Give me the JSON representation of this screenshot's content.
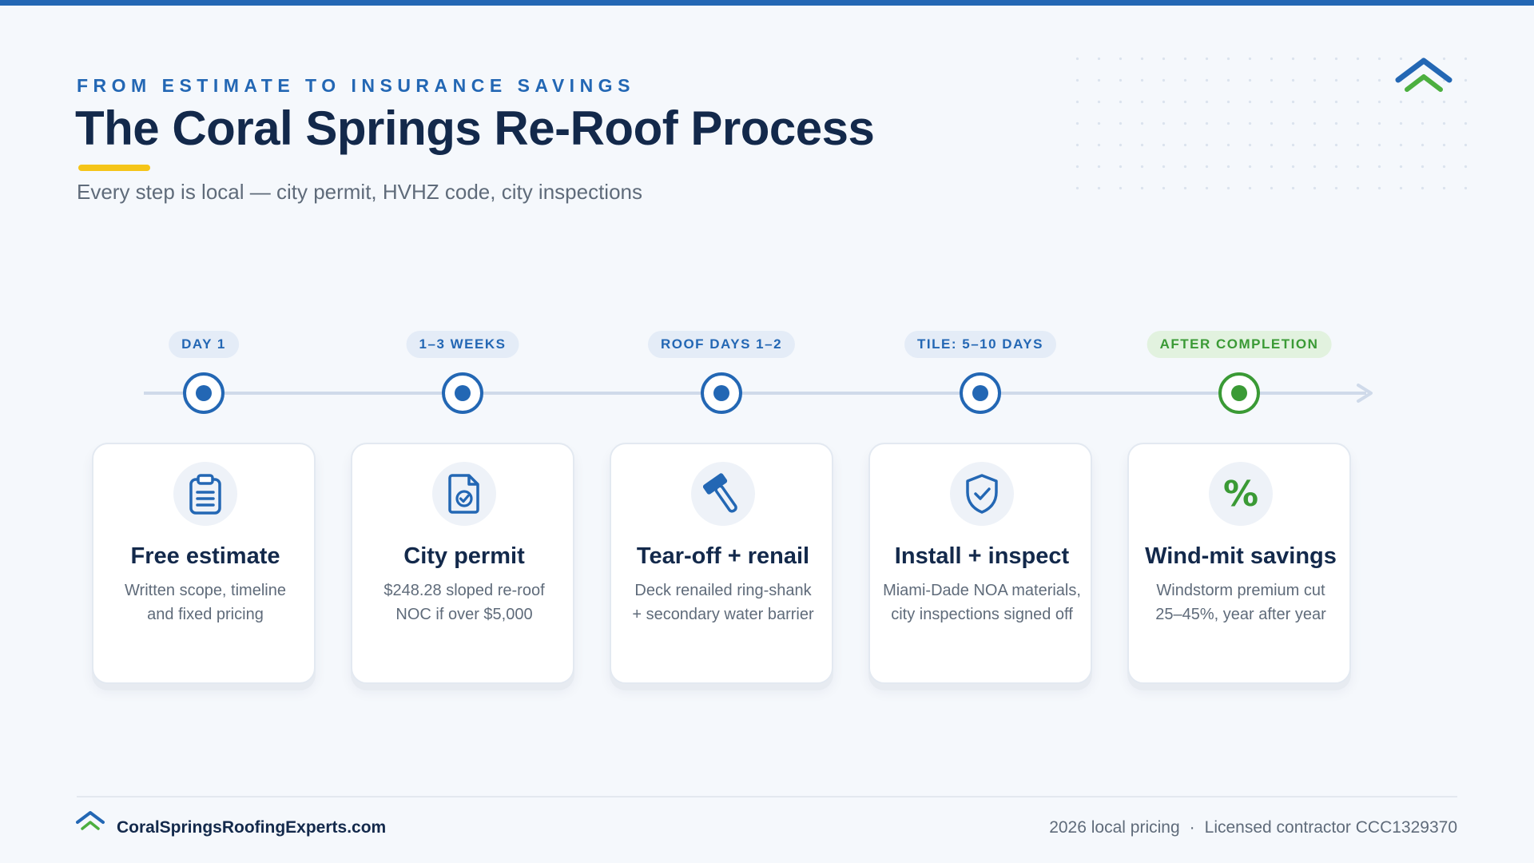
{
  "header": {
    "eyebrow": "FROM ESTIMATE TO INSURANCE SAVINGS",
    "title": "The Coral Springs Re-Roof Process",
    "subtitle": "Every step is local — city permit, HVHZ code, city inspections"
  },
  "steps": [
    {
      "badge": "DAY 1",
      "icon": "clipboard-icon",
      "title": "Free estimate",
      "desc_line1": "Written scope, timeline",
      "desc_line2": "and fixed pricing"
    },
    {
      "badge": "1–3 WEEKS",
      "icon": "document-check-icon",
      "title": "City permit",
      "desc_line1": "$248.28 sloped re-roof",
      "desc_line2": "NOC if over $5,000"
    },
    {
      "badge": "ROOF DAYS 1–2",
      "icon": "hammer-icon",
      "title": "Tear-off + renail",
      "desc_line1": "Deck renailed ring-shank",
      "desc_line2": "+ secondary water barrier"
    },
    {
      "badge": "TILE: 5–10 DAYS",
      "icon": "shield-check-icon",
      "title": "Install + inspect",
      "desc_line1": "Miami-Dade NOA materials,",
      "desc_line2": "city inspections signed off"
    },
    {
      "badge": "AFTER COMPLETION",
      "icon": "percent-icon",
      "icon_glyph": "%",
      "title": "Wind-mit savings",
      "desc_line1": "Windstorm premium cut",
      "desc_line2": "25–45%, year after year"
    }
  ],
  "footer": {
    "site": "CoralSpringsRoofingExperts.com",
    "pricing": "2026 local pricing",
    "separator": "·",
    "license": "Licensed contractor CCC1329370"
  },
  "colors": {
    "primary": "#2367b4",
    "navy": "#13294b",
    "accent_yellow": "#f5c518",
    "green": "#3a9a35",
    "background": "#f5f8fc"
  }
}
